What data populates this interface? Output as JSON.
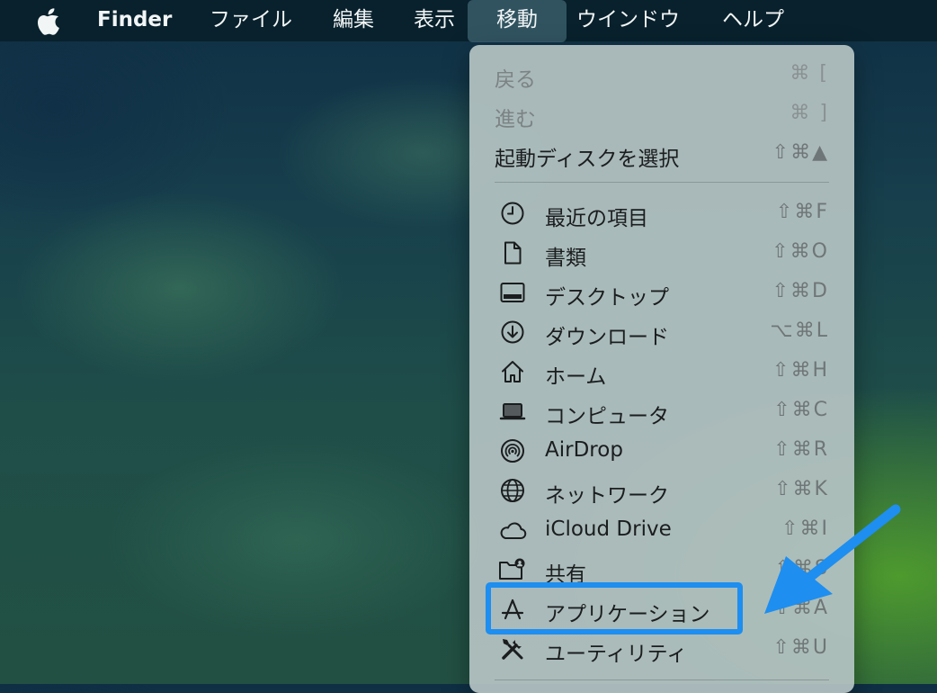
{
  "menubar": {
    "apple_icon": "apple-logo-icon",
    "app_name": "Finder",
    "items": [
      "ファイル",
      "編集",
      "表示",
      "移動",
      "ウインドウ",
      "ヘルプ"
    ],
    "active_item": "移動"
  },
  "menu": {
    "items": [
      {
        "label": "戻る",
        "shortcut": "⌘ [",
        "enabled": false
      },
      {
        "label": "進む",
        "shortcut": "⌘ ]",
        "enabled": false
      },
      {
        "label": "起動ディスクを選択",
        "shortcut": "⇧⌘▲",
        "enabled": true
      },
      {
        "label": "最近の項目",
        "shortcut": "⇧⌘F",
        "icon": "clock-icon"
      },
      {
        "label": "書類",
        "shortcut": "⇧⌘O",
        "icon": "document-icon"
      },
      {
        "label": "デスクトップ",
        "shortcut": "⇧⌘D",
        "icon": "desktop-icon"
      },
      {
        "label": "ダウンロード",
        "shortcut": "⌥⌘L",
        "icon": "download-icon"
      },
      {
        "label": "ホーム",
        "shortcut": "⇧⌘H",
        "icon": "home-icon"
      },
      {
        "label": "コンピュータ",
        "shortcut": "⇧⌘C",
        "icon": "laptop-icon"
      },
      {
        "label": "AirDrop",
        "shortcut": "⇧⌘R",
        "icon": "airdrop-icon"
      },
      {
        "label": "ネットワーク",
        "shortcut": "⇧⌘K",
        "icon": "globe-icon"
      },
      {
        "label": "iCloud Drive",
        "shortcut": "⇧⌘I",
        "icon": "cloud-icon"
      },
      {
        "label": "共有",
        "shortcut": "⇧⌘S",
        "icon": "shared-folder-icon"
      },
      {
        "label": "アプリケーション",
        "shortcut": "⇧⌘A",
        "icon": "applications-icon",
        "highlighted": true
      },
      {
        "label": "ユーティリティ",
        "shortcut": "⇧⌘U",
        "icon": "utilities-icon"
      }
    ]
  },
  "annotation": {
    "color": "#1e8ef0",
    "target": "アプリケーション"
  }
}
